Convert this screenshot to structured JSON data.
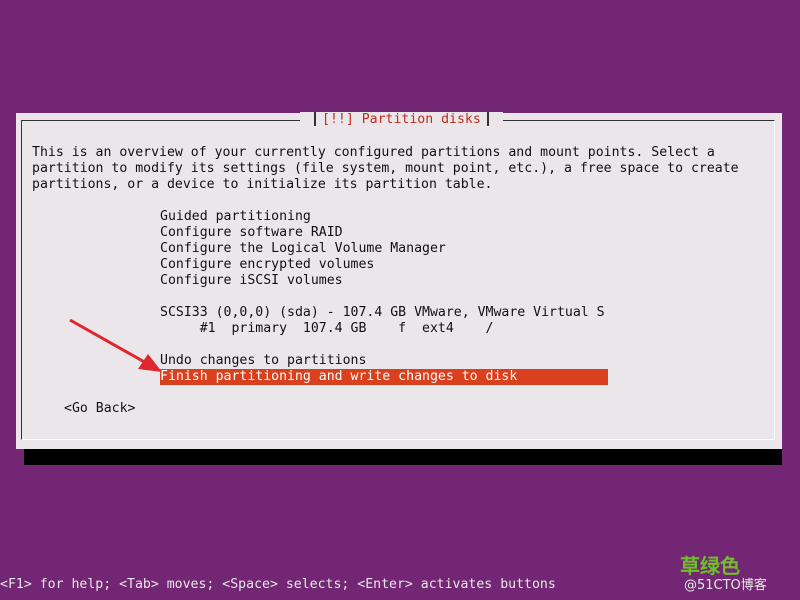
{
  "dialog": {
    "title": "[!!] Partition disks",
    "description": [
      "This is an overview of your currently configured partitions and mount points. Select a",
      "partition to modify its settings (file system, mount point, etc.), a free space to create",
      "partitions, or a device to initialize its partition table."
    ],
    "menu": [
      "Guided partitioning",
      "Configure software RAID",
      "Configure the Logical Volume Manager",
      "Configure encrypted volumes",
      "Configure iSCSI volumes"
    ],
    "disk": "SCSI33 (0,0,0) (sda) - 107.4 GB VMware, VMware Virtual S",
    "partition": "     #1  primary  107.4 GB    f  ext4    /",
    "undo": "Undo changes to partitions",
    "finish": "Finish partitioning and write changes to disk",
    "go_back": "<Go Back>"
  },
  "help_line": "<F1> for help; <Tab> moves; <Space> selects; <Enter> activates buttons",
  "watermark": {
    "primary": "草绿色",
    "secondary": "@51CTO博客"
  },
  "colors": {
    "background": "#732673",
    "dialog": "#ebe6ea",
    "highlight": "#d9401d",
    "title": "#c42b1c",
    "arrow": "#e0262e"
  }
}
